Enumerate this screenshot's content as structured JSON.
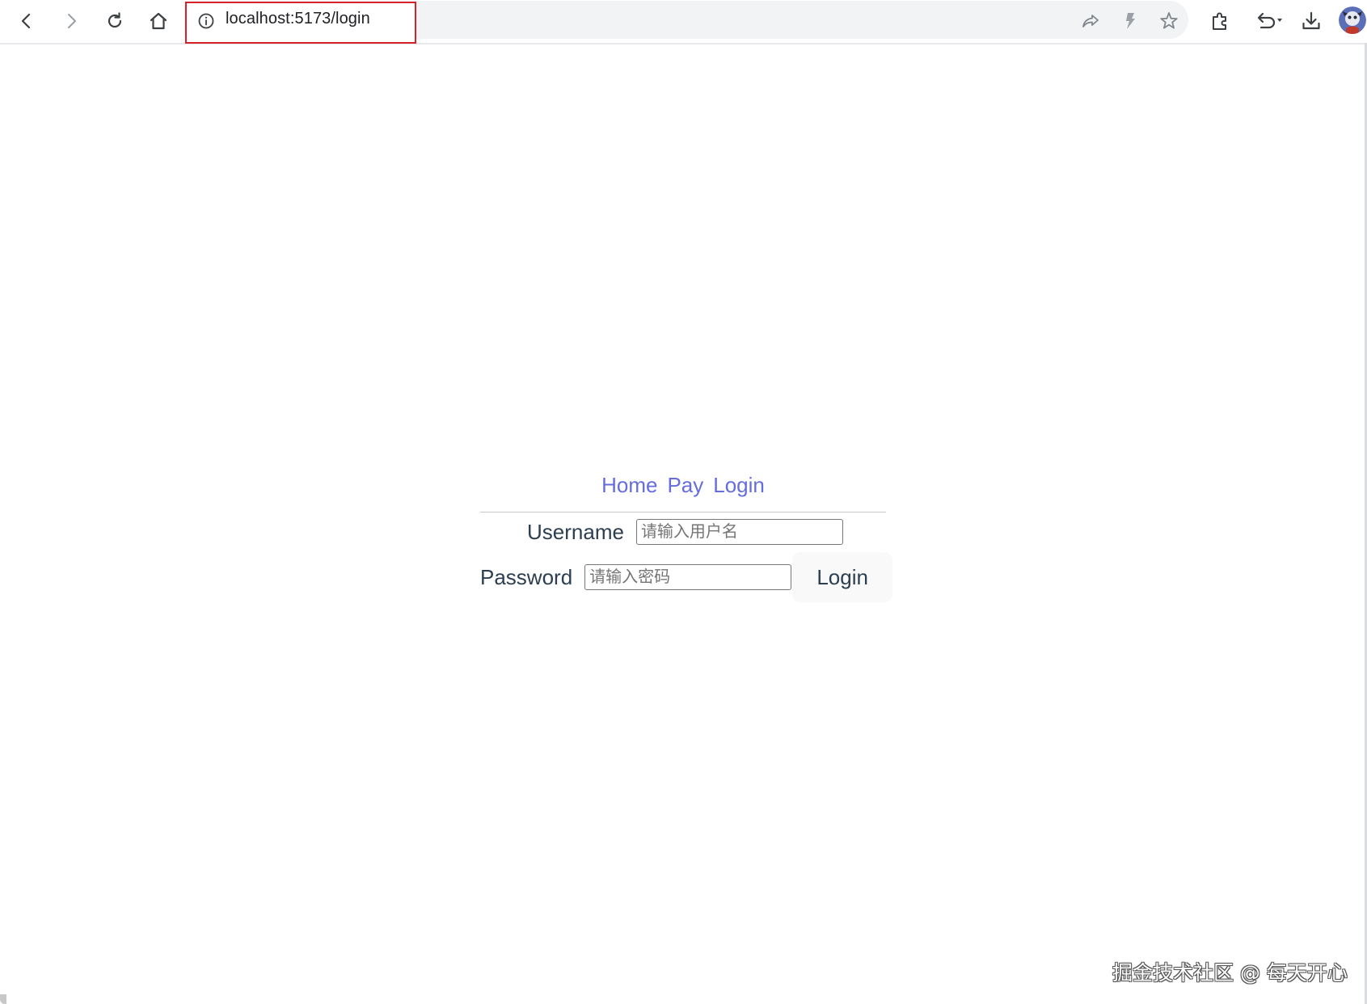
{
  "browser": {
    "url": "localhost:5173/login",
    "buttons": {
      "back": "back-icon",
      "forward": "forward-icon",
      "reload": "reload-icon",
      "home": "home-icon",
      "site_info": "info-icon",
      "share": "share-icon",
      "bolt": "bolt-icon",
      "bookmark": "star-icon",
      "extensions": "puzzle-icon",
      "undo": "undo-icon",
      "download": "download-icon"
    },
    "highlight_color": "#d6222b"
  },
  "nav": {
    "links": [
      "Home",
      "Pay",
      "Login"
    ],
    "link_color": "#646cdf"
  },
  "form": {
    "username_label": "Username",
    "username_placeholder": "请输入用户名",
    "password_label": "Password",
    "password_placeholder": "请输入密码",
    "login_button": "Login"
  },
  "watermark": "掘金技术社区 @ 每天开心"
}
